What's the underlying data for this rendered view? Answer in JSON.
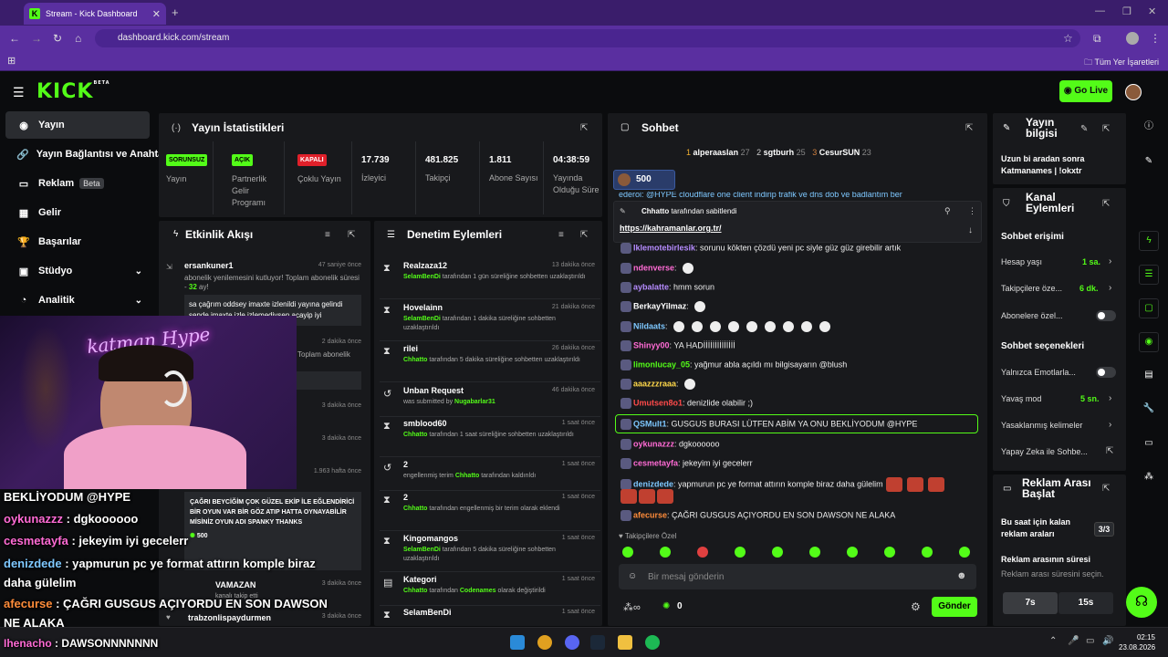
{
  "browser": {
    "tab_title": "Stream - Kick Dashboard",
    "url": "dashboard.kick.com/stream",
    "bookmarks_label": "Tüm Yer İşaretleri"
  },
  "header": {
    "logo": "KICK",
    "logo_sup": "BETA",
    "go_live": "Go Live",
    "accent": "#53fc18"
  },
  "sidebar": {
    "items": [
      {
        "label": "Yayın",
        "icon": "broadcast-icon"
      },
      {
        "label": "Yayın Bağlantısı ve Anahtarı",
        "icon": "link-icon"
      },
      {
        "label": "Reklam",
        "icon": "ad-icon",
        "badge": "Beta"
      },
      {
        "label": "Gelir",
        "icon": "revenue-icon"
      },
      {
        "label": "Başarılar",
        "icon": "trophy-icon"
      },
      {
        "label": "Stüdyo",
        "icon": "studio-icon"
      },
      {
        "label": "Analitik",
        "icon": "analytics-icon"
      }
    ]
  },
  "stats": {
    "title": "Yayın İstatistikleri",
    "items": [
      {
        "badge": "SORUNSUZ",
        "label": "Yayın"
      },
      {
        "badge": "AÇIK",
        "label": "Partnerlik Gelir Programı"
      },
      {
        "badge": "KAPALI",
        "label": "Çoklu Yayın"
      },
      {
        "value": "17.739",
        "label": "İzleyici"
      },
      {
        "value": "481.825",
        "label": "Takipçi"
      },
      {
        "value": "1.811",
        "label": "Abone Sayısı"
      },
      {
        "value": "04:38:59",
        "label": "Yayında Olduğu Süre"
      }
    ]
  },
  "activity": {
    "title": "Etkinlik Akışı",
    "items": [
      {
        "user": "ersankuner1",
        "time": "47 saniye önce",
        "text": "abonelik yenilemesini kutluyor! Toplam abonelik süresi - ",
        "months": "32",
        "months_suffix": " ay!",
        "msg": "sa çağrım oddsey imaxte izlenildi yayına gelindi sende imaxte izle izlemediysen acayip iyi"
      },
      {
        "time": "2 dakika önce",
        "text": "Toplam abonelik"
      },
      {
        "time": "3 dakika önce"
      },
      {
        "time": "3 dakika önce"
      },
      {
        "time": "1.963 hafta önce",
        "msg": "ÇAĞRI BEYCİĞİM ÇOK GÜZEL EKİP İLE EĞLENDİRİCİ BİR OYUN VAR BİR GÖZ ATIP HATTA OYNAYABİLİR MİSİNİZ OYUN ADI SPANKY THANKS",
        "kicks": "500"
      },
      {
        "user": "VAMAZAN",
        "time": "3 dakika önce",
        "text": "kanalı takip etti"
      },
      {
        "user": "trabzonlispaydurmen",
        "time": "3 dakika önce"
      }
    ]
  },
  "moderation": {
    "title": "Denetim Eylemleri",
    "items": [
      {
        "icon": "hourglass-icon",
        "name": "Realzaza12",
        "time": "13 dakika önce",
        "by": "SelamBenDi",
        "desc": " tarafından 1 gün süreliğine sohbetten uzaklaştırıldı"
      },
      {
        "icon": "hourglass-icon",
        "name": "Hovelainn",
        "time": "21 dakika önce",
        "by": "SelamBenDi",
        "desc": " tarafından 1 dakika süreliğine sohbetten uzaklaştırıldı"
      },
      {
        "icon": "hourglass-icon",
        "name": "rilei",
        "time": "26 dakika önce",
        "by": "Chhatto",
        "desc": " tarafından 5 dakika süreliğine sohbetten uzaklaştırıldı"
      },
      {
        "icon": "undo-icon",
        "name": "Unban Request",
        "time": "46 dakika önce",
        "pre": "was submitted by ",
        "by": "Nugabarlar31",
        "desc": ""
      },
      {
        "icon": "hourglass-icon",
        "name": "smblood60",
        "time": "1 saat önce",
        "by": "Chhatto",
        "desc": " tarafından 1 saat süreliğine sohbetten uzaklaştırıldı"
      },
      {
        "icon": "undo-icon",
        "name": "2",
        "time": "1 saat önce",
        "pre": "engellenmiş terim ",
        "by": "Chhatto",
        "desc": " tarafından kaldırıldı"
      },
      {
        "icon": "hourglass-icon",
        "name": "2",
        "time": "1 saat önce",
        "by": "Chhatto",
        "desc": " tarafından engellenmiş bir terim olarak eklendi"
      },
      {
        "icon": "hourglass-icon",
        "name": "Kingomangos",
        "time": "1 saat önce",
        "by": "SelamBenDi",
        "desc": " tarafından 5 dakika süreliğine sohbetten uzaklaştırıldı"
      },
      {
        "icon": "category-icon",
        "name": "Kategori",
        "time": "1 saat önce",
        "by": "Chhatto",
        "desc": " tarafından ",
        "by2": "Codenames",
        "desc2": " olarak değiştirildi"
      },
      {
        "icon": "hourglass-icon",
        "name": "SelamBenDi",
        "time": "1 saat önce"
      }
    ]
  },
  "chat": {
    "title": "Sohbet",
    "top_gifters": [
      {
        "name": "alperaaslan",
        "count": "27",
        "rank": "1"
      },
      {
        "name": "sgtburh",
        "count": "25",
        "rank": "2"
      },
      {
        "name": "CesurSUN",
        "count": "23",
        "rank": "3"
      }
    ],
    "kicks_pill": "500",
    "cut_line": "ederoi: @HYPE cloudflare one client indirip trafik ve dns dob ve badlantım ber",
    "pinned": {
      "by": "Chhatto",
      "by_suffix": " tarafından sabitlendi",
      "link": "https://kahramanlar.org.tr/"
    },
    "messages": [
      {
        "user": "Iklemotebirlesik",
        "color": "#b68cff",
        "text": ": sorunu kökten çözdü yeni pc siyle güz güz girebilir artık"
      },
      {
        "user": "ndenverse",
        "color": "#ff6bd5",
        "text": ":"
      },
      {
        "user": "aybalatte",
        "color": "#b68cff",
        "text": ": hmm sorun"
      },
      {
        "user": "BerkayYilmaz",
        "color": "#ffffff",
        "text": ":"
      },
      {
        "user": "Nildaats",
        "color": "#7ec8ff",
        "text": ":"
      },
      {
        "user": "Shinyy00",
        "color": "#ff6bd5",
        "text": ": YA HADİİİİİİİİİİİİİİ"
      },
      {
        "user": "limonlucay_05",
        "color": "#53fc18",
        "text": ": yağmur abla açıldı mı bilgisayarın @blush"
      },
      {
        "user": "aaazzzraaa",
        "color": "#ffd84a",
        "text": ":"
      },
      {
        "user": "Umutsen8o1",
        "color": "#ff4a4a",
        "text": ": denizlide olabilir ;)"
      },
      {
        "user": "QSMult1",
        "color": "#7ec8ff",
        "text": ": GUSGUS BURASI LÜTFEN ABİM YA ONU BEKLİYODUM @HYPE"
      },
      {
        "user": "oykunazzz",
        "color": "#ff6bd5",
        "text": ": dgkoooooo"
      },
      {
        "user": "cesmetayfa",
        "color": "#ff6bd5",
        "text": ": jekeyim iyi gecelerr"
      },
      {
        "user": "denizdede",
        "color": "#7ec8ff",
        "text": ": yapmurun pc ye format attırın komple biraz daha gülelim"
      },
      {
        "user": "afecurse",
        "color": "#ff8c3a",
        "text": ": ÇAĞRI GUSGUS AÇIYORDU EN SON DAWSON NE ALAKA"
      }
    ],
    "follower_label": "Takipçilere Özel",
    "input_placeholder": "Bir mesaj gönderin",
    "kicks_count": "0",
    "send_label": "Gönder"
  },
  "stream_info": {
    "title": "Yayın bilgisi",
    "text": "Uzun bi aradan sonra Katmanames | !okxtr"
  },
  "channel_actions": {
    "title": "Kanal Eylemleri",
    "chat_access": "Sohbet erişimi",
    "rows": [
      {
        "label": "Hesap yaşı",
        "value": "1 sa."
      },
      {
        "label": "Takipçilere öze...",
        "value": "6 dk."
      },
      {
        "label": "Abonelere özel..."
      }
    ],
    "chat_options": "Sohbet seçenekleri",
    "rows2": [
      {
        "label": "Yalnızca Emotlarla..."
      },
      {
        "label": "Yavaş mod",
        "value": "5 sn."
      },
      {
        "label": "Yasaklanmış kelimeler"
      },
      {
        "label": "Yapay Zeka ile Sohbe..."
      }
    ]
  },
  "ad_break": {
    "title": "Reklam Arası Başlat",
    "remaining_label": "Bu saat için kalan reklam araları",
    "remaining": "3/3",
    "duration_label": "Reklam arasının süresi",
    "duration_hint": "Reklam arası süresini seçin.",
    "opt1": "7s",
    "opt2": "15s"
  },
  "overlay": {
    "lines": [
      {
        "user": "",
        "text": "BEKLİYODUM @HYPE"
      },
      {
        "user": "oykunazzz",
        "text": " : dgkoooooo"
      },
      {
        "user": "cesmetayfa",
        "text": " : jekeyim iyi gecelerr"
      },
      {
        "user": "denizdede",
        "text": " : yapmurun pc ye format attırın komple biraz"
      },
      {
        "user": "",
        "text": "daha gülelim"
      },
      {
        "user": "afecurse",
        "text": " : ÇAĞRI GUSGUS AÇIYORDU EN SON DAWSON"
      },
      {
        "user": "",
        "text": "NE ALAKA"
      },
      {
        "user": "Ihenacho",
        "text": " : DAWSONNNNNNN"
      }
    ],
    "neon": "katman Hype"
  },
  "taskbar": {
    "time": "02:15",
    "date": "23.08.2026"
  }
}
